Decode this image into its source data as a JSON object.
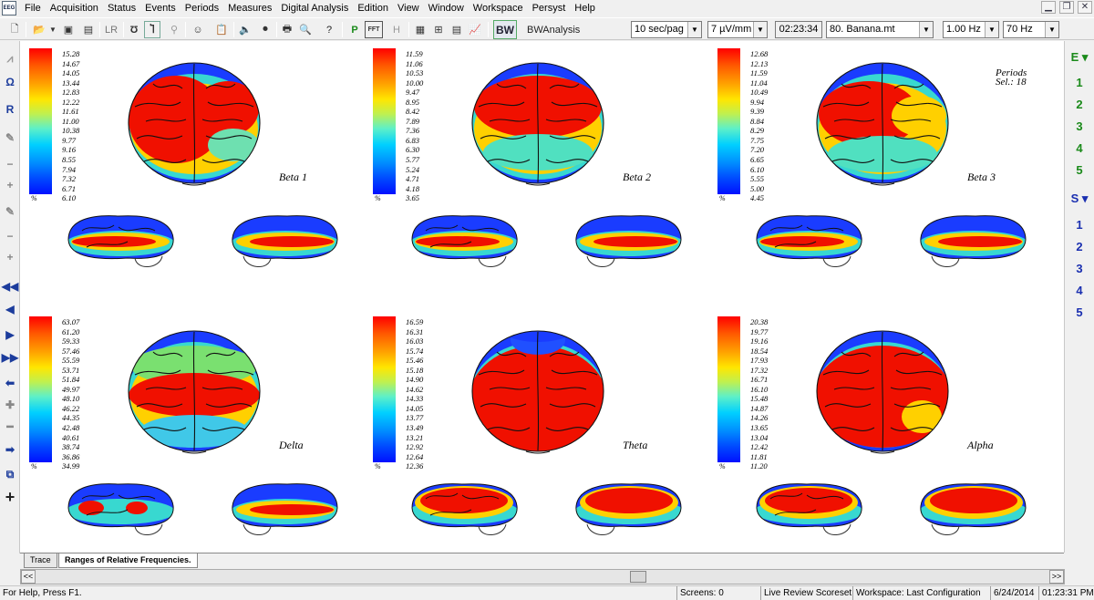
{
  "menubar": {
    "app_icon_text": "EEG",
    "items": [
      "File",
      "Acquisition",
      "Status",
      "Events",
      "Periods",
      "Measures",
      "Digital Analysis",
      "Edition",
      "View",
      "Window",
      "Workspace",
      "Persyst",
      "Help"
    ]
  },
  "toolbar": {
    "lr_label": "LR",
    "h_label": "H",
    "fft_label": "FFT",
    "bw_label": "BW",
    "bwanalysis_label": "BWAnalysis",
    "page_speed": "10 sec/pag",
    "sensitivity": "7 µV/mm",
    "time": "02:23:34",
    "montage": "80. Banana.mt",
    "lowcut": "1.00 Hz",
    "highcut": "70 Hz"
  },
  "right_panel": {
    "e_label": "E",
    "e_items": [
      "1",
      "2",
      "3",
      "4",
      "5"
    ],
    "s_label": "S",
    "s_items": [
      "1",
      "2",
      "3",
      "4",
      "5"
    ],
    "e_color": "#1a8a1a",
    "s_color": "#1a2fb0"
  },
  "maps": {
    "periods_line1": "Periods",
    "periods_line2": "Sel.: 18",
    "percent_symbol": "%",
    "bands": [
      {
        "name": "Beta 1",
        "scale": [
          "15.28",
          "14.67",
          "14.05",
          "13.44",
          "12.83",
          "12.22",
          "11.61",
          "11.00",
          "10.38",
          "9.77",
          "9.16",
          "8.55",
          "7.94",
          "7.32",
          "6.71",
          "6.10"
        ]
      },
      {
        "name": "Beta 2",
        "scale": [
          "11.59",
          "11.06",
          "10.53",
          "10.00",
          "9.47",
          "8.95",
          "8.42",
          "7.89",
          "7.36",
          "6.83",
          "6.30",
          "5.77",
          "5.24",
          "4.71",
          "4.18",
          "3.65"
        ]
      },
      {
        "name": "Beta 3",
        "scale": [
          "12.68",
          "12.13",
          "11.59",
          "11.04",
          "10.49",
          "9.94",
          "9.39",
          "8.84",
          "8.29",
          "7.75",
          "7.20",
          "6.65",
          "6.10",
          "5.55",
          "5.00",
          "4.45"
        ]
      },
      {
        "name": "Delta",
        "scale": [
          "63.07",
          "61.20",
          "59.33",
          "57.46",
          "55.59",
          "53.71",
          "51.84",
          "49.97",
          "48.10",
          "46.22",
          "44.35",
          "42.48",
          "40.61",
          "38.74",
          "36.86",
          "34.99"
        ]
      },
      {
        "name": "Theta",
        "scale": [
          "16.59",
          "16.31",
          "16.03",
          "15.74",
          "15.46",
          "15.18",
          "14.90",
          "14.62",
          "14.33",
          "14.05",
          "13.77",
          "13.49",
          "13.21",
          "12.92",
          "12.64",
          "12.36"
        ]
      },
      {
        "name": "Alpha",
        "scale": [
          "20.38",
          "19.77",
          "19.16",
          "18.54",
          "17.93",
          "17.32",
          "16.71",
          "16.10",
          "15.48",
          "14.87",
          "14.26",
          "13.65",
          "13.04",
          "12.42",
          "11.81",
          "11.20"
        ]
      }
    ]
  },
  "tabs": [
    "Trace",
    "Ranges of Relative Frequencies."
  ],
  "scrollbar": {
    "left_arrow": "<<",
    "right_arrow": ">>"
  },
  "status": {
    "help": "For Help, Press F1.",
    "screens": "Screens: 0",
    "review": "Live Review Scoreset",
    "workspace": "Workspace: Last Configuration",
    "date": "6/24/2014",
    "clock": "01:23:31 PM"
  }
}
